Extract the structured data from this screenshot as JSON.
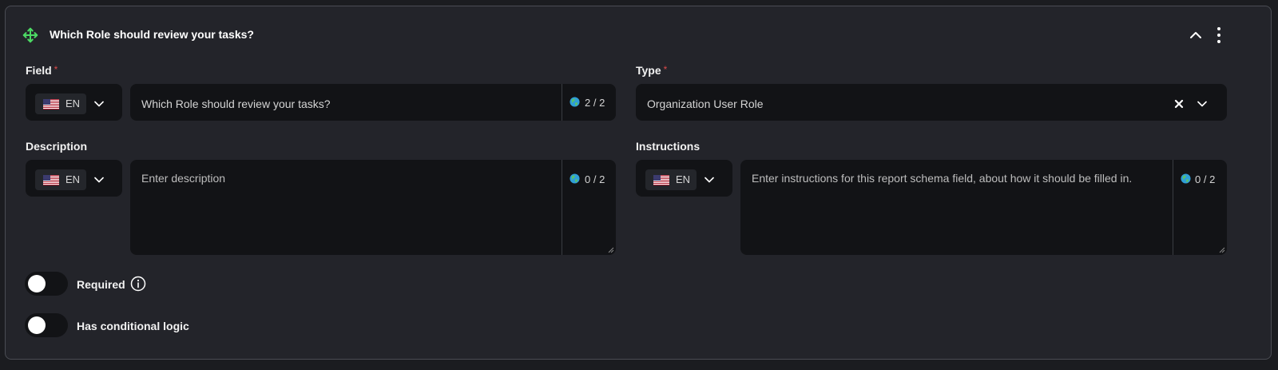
{
  "card": {
    "title": "Which Role should review your tasks?",
    "icons": {
      "drag": "move-arrows-icon",
      "collapse": "chevron-up-icon",
      "menu": "more-vertical-icon"
    }
  },
  "field": {
    "label": "Field",
    "required_mark": "*",
    "lang": "EN",
    "value": "Which Role should review your tasks?",
    "counter": "2 / 2"
  },
  "type": {
    "label": "Type",
    "required_mark": "*",
    "value": "Organization User Role"
  },
  "description": {
    "label": "Description",
    "lang": "EN",
    "placeholder": "Enter description",
    "counter": "0 / 2"
  },
  "instructions": {
    "label": "Instructions",
    "lang": "EN",
    "placeholder": "Enter instructions for this report schema field, about how it should be filled in.",
    "counter": "0 / 2"
  },
  "toggles": {
    "required": {
      "label": "Required",
      "on": false
    },
    "conditional": {
      "label": "Has conditional logic",
      "on": false
    }
  },
  "colors": {
    "accent_green": "#4cd964",
    "required_red": "#d94a4a",
    "card_bg": "#23242a",
    "input_bg": "#121316"
  }
}
